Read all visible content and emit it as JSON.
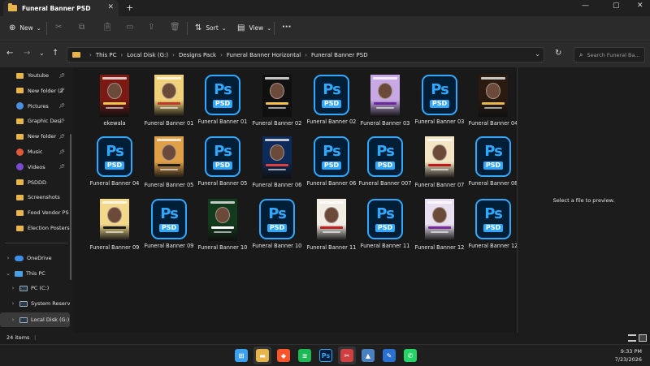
{
  "window": {
    "tab_title": "Funeral Banner PSD",
    "tab_close": "✕",
    "new_tab": "+",
    "minimize": "—",
    "maximize": "▢",
    "close": "✕"
  },
  "command_bar": {
    "new_label": "New",
    "sort_label": "Sort",
    "view_label": "View",
    "more_label": "···"
  },
  "address": {
    "crumbs": [
      "This PC",
      "Local Disk (G:)",
      "Designs Pack",
      "Funeral Banner Horizontal",
      "Funeral Banner PSD"
    ],
    "search_placeholder": "Search Funeral Ba..."
  },
  "sidebar": {
    "quick_access": [
      {
        "label": "Youtube",
        "pinned": true
      },
      {
        "label": "New folder (2",
        "pinned": true
      },
      {
        "label": "Pictures",
        "pinned": true
      },
      {
        "label": "Graphic Desi",
        "pinned": true
      },
      {
        "label": "New folder",
        "pinned": true
      },
      {
        "label": "Music",
        "pinned": true
      },
      {
        "label": "Videos",
        "pinned": true
      },
      {
        "label": "PSDDD",
        "pinned": false
      },
      {
        "label": "Screenshots",
        "pinned": false
      },
      {
        "label": "Food Vendor PS",
        "pinned": false
      },
      {
        "label": "Election Posters",
        "pinned": false
      }
    ],
    "tree": [
      {
        "label": "OneDrive",
        "chev": "›"
      },
      {
        "label": "This PC",
        "chev": "⌄"
      },
      {
        "label": "PC (C:)",
        "chev": "›"
      },
      {
        "label": "System Reserv",
        "chev": "›"
      },
      {
        "label": "Local Disk (G:)",
        "chev": "›"
      }
    ]
  },
  "files": [
    {
      "name": "ekewala",
      "kind": "img",
      "bg": "#7a1a12",
      "accent": "#f2c14e"
    },
    {
      "name": "Funeral Banner 01",
      "kind": "img",
      "bg": "#f1d27a",
      "accent": "#c0392b"
    },
    {
      "name": "Funeral Banner 01",
      "kind": "psd"
    },
    {
      "name": "Funeral Banner 02",
      "kind": "img",
      "bg": "#101010",
      "accent": "#f2c14e"
    },
    {
      "name": "Funeral Banner 02",
      "kind": "psd"
    },
    {
      "name": "Funeral Banner 03",
      "kind": "img",
      "bg": "#c9a8e6",
      "accent": "#6a2a9a"
    },
    {
      "name": "Funeral Banner 03",
      "kind": "psd"
    },
    {
      "name": "Funeral Banner 04",
      "kind": "img",
      "bg": "#2a1a10",
      "accent": "#e6b84c"
    },
    {
      "name": "Funeral Banner 04",
      "kind": "psd"
    },
    {
      "name": "Funeral Banner 05",
      "kind": "img",
      "bg": "#e0a048",
      "accent": "#1a1a1a"
    },
    {
      "name": "Funeral Banner 05",
      "kind": "psd"
    },
    {
      "name": "Funeral Banner 06",
      "kind": "img",
      "bg": "#0c2a5a",
      "accent": "#e04040"
    },
    {
      "name": "Funeral Banner 06",
      "kind": "psd"
    },
    {
      "name": "Funeral Banner 007",
      "kind": "psd"
    },
    {
      "name": "Funeral Banner 07",
      "kind": "img",
      "bg": "#f4e6c4",
      "accent": "#c01818"
    },
    {
      "name": "Funeral Banner 08",
      "kind": "psd"
    },
    {
      "name": "Funeral Banner 09",
      "kind": "img",
      "bg": "#f3d88a",
      "accent": "#1a1a1a"
    },
    {
      "name": "Funeral Banner 09",
      "kind": "psd"
    },
    {
      "name": "Funeral Banner 10",
      "kind": "img",
      "bg": "#123a1c",
      "accent": "#ffffff"
    },
    {
      "name": "Funeral Banner 10",
      "kind": "psd"
    },
    {
      "name": "Funeral Banner 11",
      "kind": "img",
      "bg": "#f2eee6",
      "accent": "#c02020"
    },
    {
      "name": "Funeral Banner 11",
      "kind": "psd"
    },
    {
      "name": "Funeral Banner 12",
      "kind": "img",
      "bg": "#e8e0f0",
      "accent": "#7a2a9a"
    },
    {
      "name": "Funeral Banner 12",
      "kind": "psd"
    }
  ],
  "preview_text": "Select a file to preview.",
  "status": {
    "count": "24 items",
    "separator": "|"
  },
  "taskbar": {
    "time": "9:33 PM",
    "date": "7/23/2026",
    "apps": [
      {
        "name": "windows-start",
        "color": "#3aa0f0",
        "glyph": "⊞"
      },
      {
        "name": "file-explorer",
        "color": "#e8b44c",
        "glyph": "▬"
      },
      {
        "name": "brave-browser",
        "color": "#fb542b",
        "glyph": "◆"
      },
      {
        "name": "spotify",
        "color": "#1db954",
        "glyph": "≋"
      },
      {
        "name": "photoshop",
        "color": "#001e36",
        "glyph": "Ps"
      },
      {
        "name": "snipping-tool",
        "color": "#d04040",
        "glyph": "✂"
      },
      {
        "name": "photos",
        "color": "#4a80c0",
        "glyph": "▲"
      },
      {
        "name": "paint",
        "color": "#2a70d0",
        "glyph": "✎"
      },
      {
        "name": "whatsapp",
        "color": "#25d366",
        "glyph": "✆"
      }
    ]
  }
}
